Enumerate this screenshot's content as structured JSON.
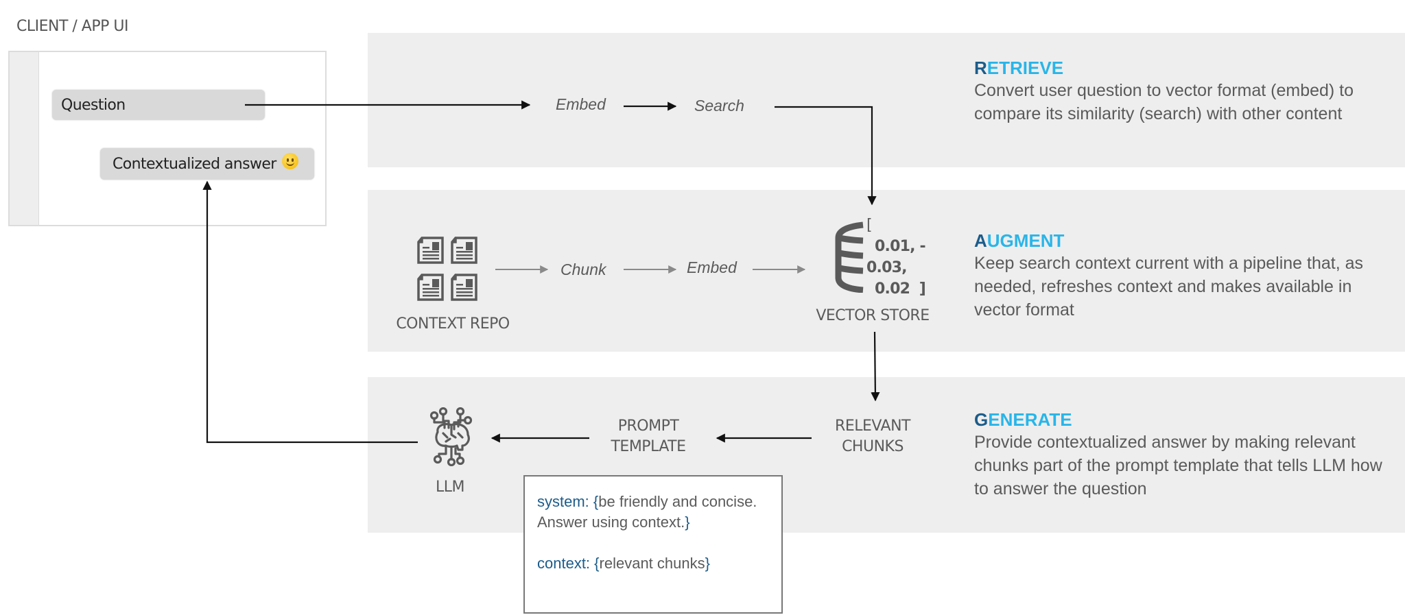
{
  "client": {
    "title": "CLIENT / APP UI",
    "question_label": "Question",
    "answer_label": "Contextualized answer",
    "answer_emoji_icon": "smiley-face-icon"
  },
  "retrieve": {
    "steps": [
      "Embed",
      "Search"
    ],
    "title_initial": "R",
    "title_rest": "ETRIEVE",
    "description": "Convert user question to vector format (embed) to compare its similarity (search) with other content"
  },
  "augment": {
    "repo_label": "CONTEXT REPO",
    "repo_icon": "documents-icon",
    "steps": [
      "Chunk",
      "Embed"
    ],
    "vector_store_label": "VECTOR STORE",
    "vector_store_icon": "database-icon",
    "vector_lines": [
      "[",
      "0.01, -",
      "0.03,",
      "0.02  ]"
    ],
    "title_initial": "A",
    "title_rest": "UGMENT",
    "description": "Keep search context current with a pipeline that, as needed, refreshes context and makes available in vector format"
  },
  "generate": {
    "llm_label": "LLM",
    "llm_icon": "brain-circuit-icon",
    "prompt_template_label": [
      "PROMPT",
      "TEMPLATE"
    ],
    "relevant_chunks_label": [
      "RELEVANT",
      "CHUNKS"
    ],
    "title_initial": "G",
    "title_rest": "ENERATE",
    "description": "Provide contextualized answer by making relevant chunks part of the prompt template that tells LLM how to answer the question",
    "prompt": {
      "system_key": "system:",
      "system_open": "{",
      "system_value": "be friendly and concise. Answer using context.",
      "system_close": "}",
      "context_key": "context:",
      "context_open": "{",
      "context_value": "relevant chunks",
      "context_close": "}"
    }
  },
  "colors": {
    "accent_light": "#29b5e8",
    "accent_dark": "#1b5c8a",
    "band": "#eeeeee",
    "text": "#5a5a5a"
  }
}
